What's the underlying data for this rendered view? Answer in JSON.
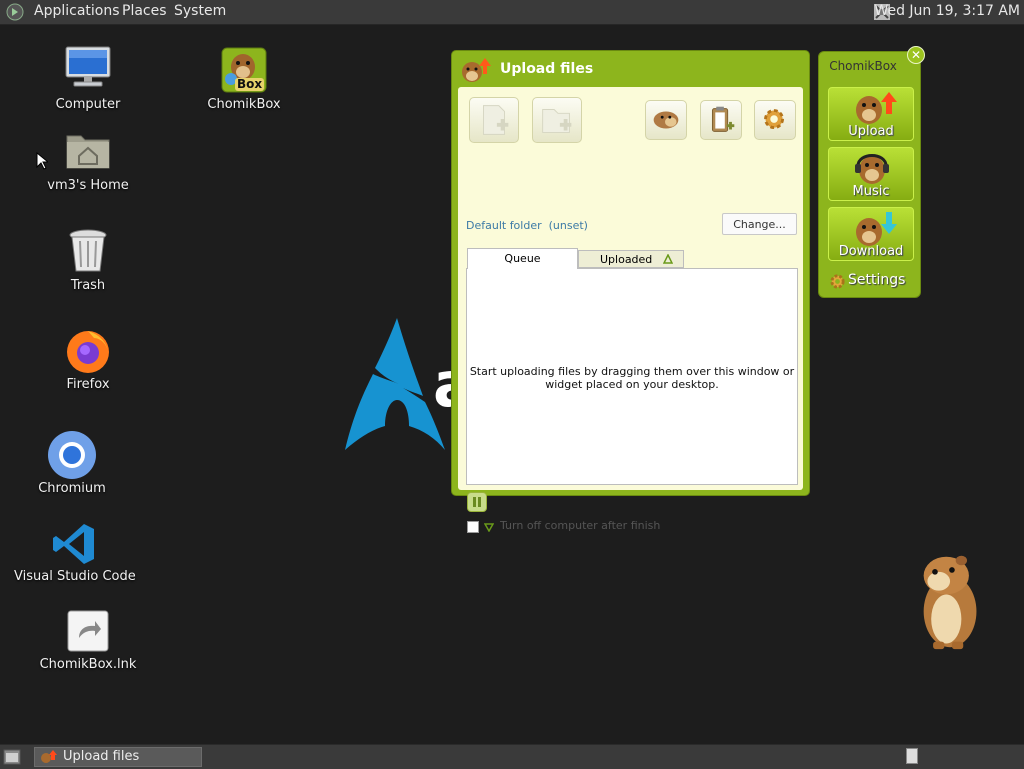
{
  "top_panel": {
    "menus": [
      "Applications",
      "Places",
      "System"
    ],
    "clock": "Wed Jun 19,  3:17 AM"
  },
  "desktop": {
    "icons": [
      {
        "label": "Computer",
        "icon": "computer-icon"
      },
      {
        "label": "ChomikBox",
        "icon": "chomikbox-icon"
      },
      {
        "label": "vm3's Home",
        "icon": "home-folder-icon"
      },
      {
        "label": "Trash",
        "icon": "trash-icon"
      },
      {
        "label": "Firefox",
        "icon": "firefox-icon"
      },
      {
        "label": "Chromium",
        "icon": "chromium-icon"
      },
      {
        "label": "Visual Studio Code",
        "icon": "vscode-icon"
      },
      {
        "label": "ChomikBox.lnk",
        "icon": "shortcut-icon"
      }
    ],
    "chomik_badge": "Box",
    "wallpaper_text": "a"
  },
  "upload_window": {
    "title": "Upload files",
    "default_folder": "Default folder",
    "folder_value": "(unset)",
    "change_label": "Change...",
    "tabs": [
      "Queue",
      "Uploaded"
    ],
    "queue_message_line1": "Start uploading files by dragging them over this window or",
    "queue_message_line2": "widget placed on your desktop.",
    "shutdown_label": "Turn off computer after finish"
  },
  "widget": {
    "title": "ChomikBox",
    "buttons": [
      "Upload",
      "Music",
      "Download"
    ],
    "settings_label": "Settings"
  },
  "taskbar": {
    "task_label": "Upload files"
  },
  "colors": {
    "accent_green": "#8db51d",
    "panel_bg": "#3a3a3a",
    "desktop_bg": "#1d1d1d",
    "arch_blue": "#1793d1"
  }
}
